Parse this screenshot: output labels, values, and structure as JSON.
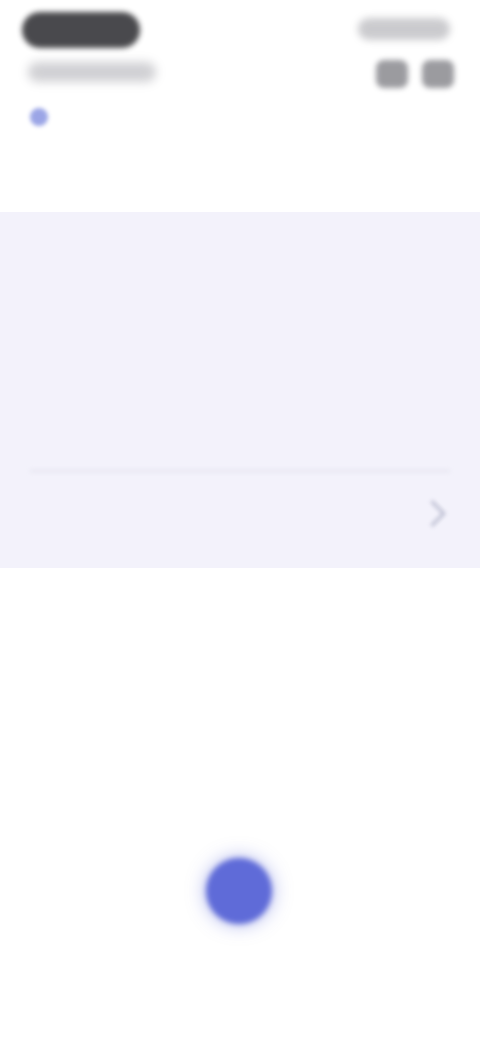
{
  "colors": {
    "accent": "#5f6bd8",
    "card_bg": "#f3f2fb",
    "muted": "#8f93a8"
  },
  "breadcrumb": {
    "link": "",
    "current": ""
  },
  "card": {
    "label": "",
    "title": "",
    "description": "",
    "meta": ""
  },
  "section2": {
    "label": "",
    "value": ""
  },
  "fab": {
    "label": ""
  }
}
